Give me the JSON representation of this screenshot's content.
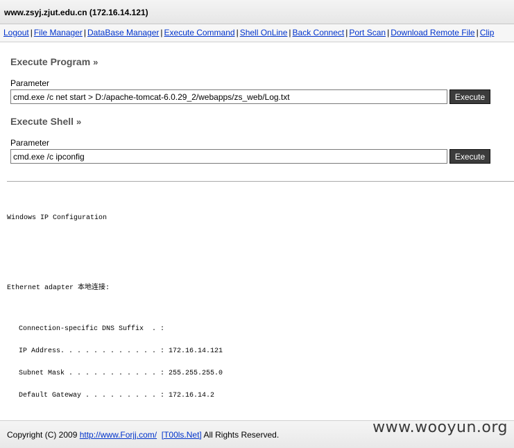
{
  "header": {
    "host": "www.zsyj.zjut.edu.cn (172.16.14.121)"
  },
  "nav": {
    "links": [
      "Logout",
      "File Manager",
      "DataBase Manager",
      "Execute Command",
      "Shell OnLine",
      "Back Connect",
      "Port Scan",
      "Download Remote File",
      "Clip"
    ],
    "separator": "|"
  },
  "program": {
    "title": "Execute Program",
    "raquo": "»",
    "parameter_label": "Parameter",
    "value": "cmd.exe /c net start > D:/apache-tomcat-6.0.29_2/webapps/zs_web/Log.txt",
    "button": "Execute"
  },
  "shell": {
    "title": "Execute Shell",
    "raquo": "»",
    "parameter_label": "Parameter",
    "value": "cmd.exe /c ipconfig",
    "button": "Execute"
  },
  "output": {
    "line1": "Windows IP Configuration",
    "line2": "Ethernet adapter 本地连接:",
    "dns": "Connection-specific DNS Suffix  . :",
    "ip": "IP Address. . . . . . . . . . . . : 172.16.14.121",
    "mask": "Subnet Mask . . . . . . . . . . . : 255.255.255.0",
    "gateway": "Default Gateway . . . . . . . . . : 172.16.14.2"
  },
  "footer": {
    "prefix": "Copyright (C) 2009 ",
    "link1": "http://www.Forjj.com/",
    "link2": "[T00ls.Net]",
    "suffix": " All Rights Reserved."
  },
  "watermark": "www.wooyun.org"
}
